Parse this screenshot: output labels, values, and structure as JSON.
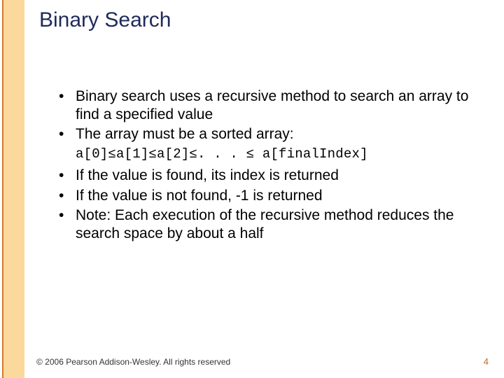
{
  "title": "Binary Search",
  "bullets_a": [
    "Binary search uses a recursive method to search an array to find a specified value",
    "The array must be a sorted array:"
  ],
  "code_line": "a[0]≤a[1]≤a[2]≤. . . ≤  a[finalIndex]",
  "bullets_b": [
    "If the value is found, its index is returned",
    "If the value is not found, -1 is returned",
    "Note:  Each execution of the recursive method reduces the search space by about a half"
  ],
  "footer": "© 2006 Pearson Addison-Wesley. All rights reserved",
  "page_number": "4"
}
